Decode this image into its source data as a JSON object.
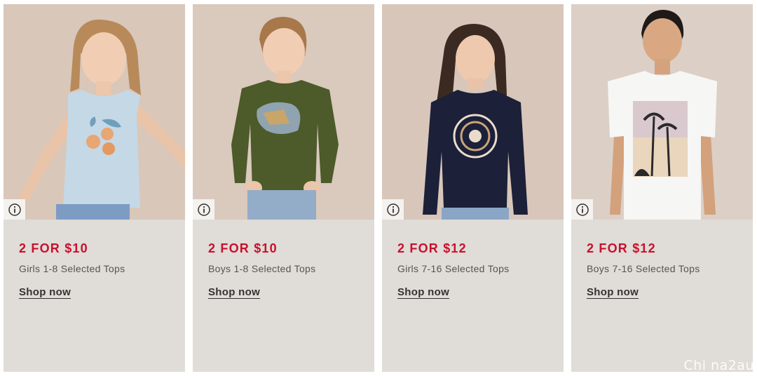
{
  "cards": [
    {
      "promo": "2 FOR $10",
      "description": "Girls 1-8 Selected Tops",
      "cta": "Shop now",
      "photo_bg": "#d9c7ba",
      "shirt_color": "#c5d8e6"
    },
    {
      "promo": "2 FOR $10",
      "description": "Boys 1-8 Selected Tops",
      "cta": "Shop now",
      "photo_bg": "#dac9bd",
      "shirt_color": "#4d5a2a"
    },
    {
      "promo": "2 FOR $12",
      "description": "Girls 7-16 Selected Tops",
      "cta": "Shop now",
      "photo_bg": "#d8c6ba",
      "shirt_color": "#1c2038"
    },
    {
      "promo": "2 FOR $12",
      "description": "Boys 7-16 Selected Tops",
      "cta": "Shop now",
      "photo_bg": "#dccfc6",
      "shirt_color": "#f6f6f4"
    }
  ],
  "info_icon": "info-circle-icon",
  "watermark": "Chi na2au",
  "colors": {
    "accent": "#c8102e",
    "card_bg": "#e0dcd7"
  }
}
